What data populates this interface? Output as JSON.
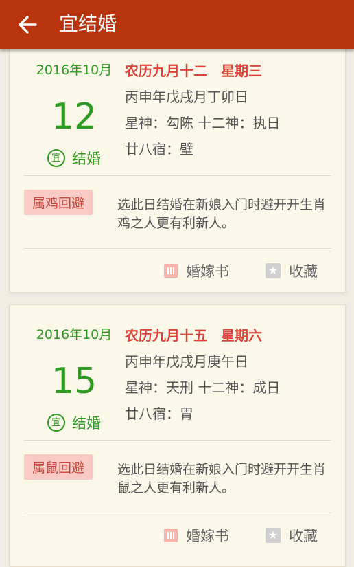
{
  "appbar": {
    "title": "宜结婚"
  },
  "days": [
    {
      "solar_month": "2016年10月",
      "day": "12",
      "yi_mark": "宜",
      "yi_event": "结婚",
      "lunar": "农历九月十二",
      "weekday": "星期三",
      "ganzhi": "丙申年戊戌月丁卯日",
      "gods": "星神：勾陈 十二神：执日",
      "mansion": "廿八宿：壁",
      "avoid_label": "属鸡回避",
      "avoid_text": "选此日结婚在新娘入门时避开开生肖鸡之人更有利新人。",
      "book_label": "婚嫁书",
      "fav_label": "收藏"
    },
    {
      "solar_month": "2016年10月",
      "day": "15",
      "yi_mark": "宜",
      "yi_event": "结婚",
      "lunar": "农历九月十五",
      "weekday": "星期六",
      "ganzhi": "丙申年戊戌月庚午日",
      "gods": "星神：天刑 十二神：成日",
      "mansion": "廿八宿：胃",
      "avoid_label": "属鼠回避",
      "avoid_text": "选此日结婚在新娘入门时避开开生肖鼠之人更有利新人。",
      "book_label": "婚嫁书",
      "fav_label": "收藏"
    }
  ]
}
